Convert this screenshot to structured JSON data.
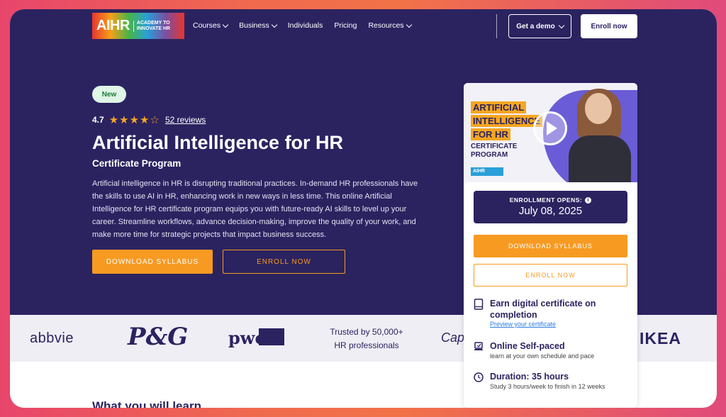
{
  "nav": {
    "logo_main": "AIHR",
    "logo_sub_line1": "ACADEMY TO",
    "logo_sub_line2": "INNOVATE HR",
    "items": [
      {
        "label": "Courses",
        "dropdown": true
      },
      {
        "label": "Business",
        "dropdown": true
      },
      {
        "label": "Individuals",
        "dropdown": false
      },
      {
        "label": "Pricing",
        "dropdown": false
      },
      {
        "label": "Resources",
        "dropdown": true
      }
    ],
    "demo_label": "Get a demo",
    "enroll_label": "Enroll now"
  },
  "hero": {
    "badge": "New",
    "rating": "4.7",
    "stars": "★★★★☆",
    "reviews": "52 reviews",
    "title": "Artificial Intelligence for HR",
    "subtitle": "Certificate Program",
    "description": "Artificial intelligence in HR is disrupting traditional practices. In-demand HR professionals have the skills to use AI in HR, enhancing work in new ways in less time. This online Artificial Intelligence for HR certificate program equips you with future-ready AI skills to level up your career. Streamline workflows, advance decision-making, improve the quality of your work, and make more time for strategic projects that impact business success.",
    "download_label": "DOWNLOAD SYLLABUS",
    "enroll_label": "ENROLL NOW"
  },
  "strip": {
    "abbvie": "abbvie",
    "pg": "P&G",
    "pwc": "pwc",
    "trusted_line1": "Trusted by 50,000+",
    "trusted_line2": "HR professionals",
    "capgemini": "Capg",
    "ikea": "IKEA"
  },
  "learn_title": "What you will learn",
  "card": {
    "video": {
      "line1": "ARTIFICIAL",
      "line2": "INTELLIGENCE",
      "line3": "FOR HR",
      "prog1": "CERTIFICATE",
      "prog2": "PROGRAM",
      "badge": "AIHR"
    },
    "enroll_opens_label": "ENROLLMENT OPENS:",
    "enroll_date": "July 08, 2025",
    "download_label": "DOWNLOAD SYLLABUS",
    "enroll_label": "ENROLL NOW",
    "features": [
      {
        "title": "Earn digital certificate on completion",
        "link": "Preview your certificate",
        "icon": "book-icon"
      },
      {
        "title": "Online Self-paced",
        "sub": "learn at your own schedule and pace",
        "icon": "laptop-icon"
      },
      {
        "title": "Duration: 35 hours",
        "sub": "Study 3 hours/week to finish in 12 weeks",
        "icon": "clock-icon"
      }
    ]
  },
  "colors": {
    "brand_navy": "#2b2360",
    "accent_orange": "#f79a22",
    "star": "#f6a623",
    "link_blue": "#2a7de1"
  }
}
